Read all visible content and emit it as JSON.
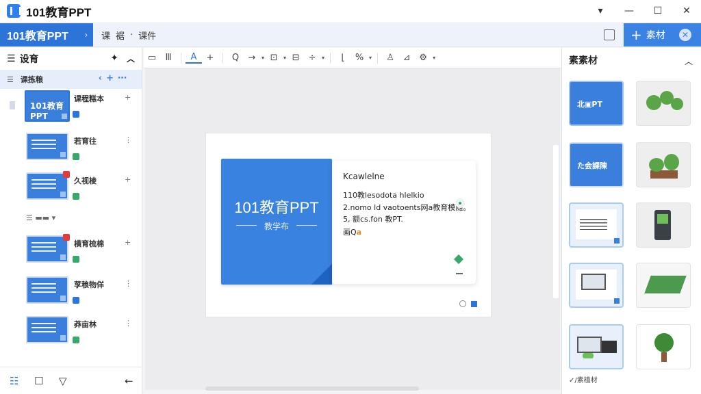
{
  "app": {
    "title": "101教育PPT",
    "window_controls": [
      "▾",
      "—",
      "☐",
      "✕"
    ]
  },
  "tabbar": {
    "doc_tab_label": "101教育PPT",
    "menu_items": [
      "课",
      "裾",
      "·",
      "课件"
    ],
    "material_button_label": "素材"
  },
  "left_panel": {
    "title": "设育",
    "subheader": "课拣粮",
    "slides": [
      {
        "thumb_text": "101教育PPT",
        "name": "课程糕本"
      },
      {
        "thumb_text": "",
        "name": "若育往"
      },
      {
        "thumb_text": "",
        "name": "久视棱"
      },
      {
        "thumb_text": "",
        "name": "横育梳棉"
      },
      {
        "thumb_text": "",
        "name": "莩稂物佯"
      },
      {
        "thumb_text": "",
        "name": "莽亩林"
      }
    ],
    "layout_label": "☰ ▬▬ ▾"
  },
  "toolbar": {
    "items": [
      "▭",
      "Ⅲ",
      "A",
      "+",
      "Q",
      "→",
      "▾",
      "⊡",
      "▾",
      "⊟",
      "÷",
      "▾",
      "⌊",
      "%",
      "▾",
      "♙",
      "⊿",
      "⚙",
      "▾"
    ]
  },
  "slide": {
    "title": "101教育PPT",
    "subtitle": "教学布",
    "card_heading": "Kcawlelne",
    "card_lines": [
      "110教lesodota hlelkio",
      "2.nomo ld vaotoents网a教育模随。",
      "5, 额cs.fon 教PT."
    ],
    "card_footer_prefix": "画Q",
    "card_footer_highlight": "a"
  },
  "right_panel": {
    "title": "素素材",
    "assets": [
      {
        "label": "北▣PT",
        "kind": "blue"
      },
      {
        "label": "",
        "kind": "plants"
      },
      {
        "label": "た会課陳",
        "kind": "blue"
      },
      {
        "label": "",
        "kind": "potted-plant"
      },
      {
        "label": "",
        "kind": "card"
      },
      {
        "label": "",
        "kind": "phone"
      },
      {
        "label": "",
        "kind": "computer"
      },
      {
        "label": "",
        "kind": "board"
      },
      {
        "label": "",
        "kind": "desktop"
      },
      {
        "label": "",
        "kind": "tree"
      }
    ],
    "footer_label": "✓/素植材"
  },
  "colors": {
    "accent": "#2c74d8",
    "slide_blue": "#3a82e0",
    "green": "#3aa76d",
    "red_badge": "#e23b3b"
  }
}
